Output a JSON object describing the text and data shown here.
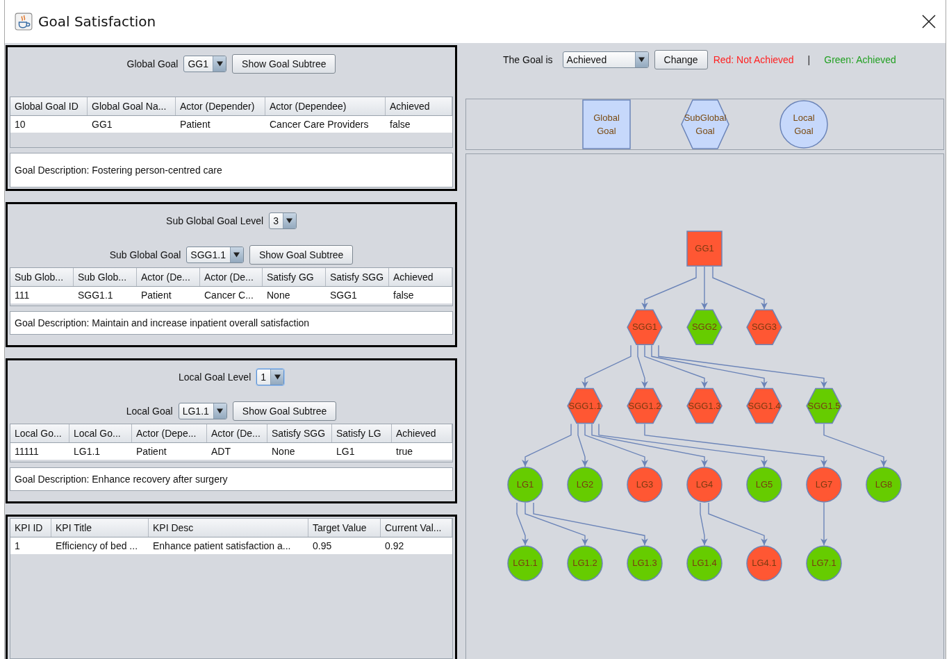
{
  "window": {
    "title": "Goal Satisfaction"
  },
  "sections": [
    {
      "control_rows": [
        {
          "label": "Global Goal",
          "dropdown": {
            "value": "GG1",
            "focused": false
          },
          "button": "Show Goal Subtree"
        }
      ],
      "table": {
        "columns": [
          "Global Goal ID",
          "Global Goal Na...",
          "Actor (Depender)",
          "Actor (Dependee)",
          "Achieved"
        ],
        "rows": [
          [
            "10",
            "GG1",
            "Patient",
            "Cancer Care Providers",
            "false"
          ]
        ]
      },
      "description": "Goal Description: Fostering person-centred care"
    },
    {
      "control_rows": [
        {
          "label": "Sub Global Goal Level",
          "dropdown": {
            "value": "3",
            "focused": false
          }
        },
        {
          "label": "Sub Global Goal",
          "dropdown": {
            "value": "SGG1.1",
            "focused": false
          },
          "button": "Show Goal Subtree"
        }
      ],
      "table": {
        "columns": [
          "Sub Glob...",
          "Sub Glob...",
          "Actor (De...",
          "Actor (De...",
          "Satisfy GG",
          "Satisfy SGG",
          "Achieved"
        ],
        "rows": [
          [
            "111",
            "SGG1.1",
            "Patient",
            "Cancer C...",
            "None",
            "SGG1",
            "false"
          ]
        ]
      },
      "description": "Goal Description: Maintain and increase inpatient overall satisfaction"
    },
    {
      "control_rows": [
        {
          "label": "Local Goal Level",
          "dropdown": {
            "value": "1",
            "focused": true
          }
        },
        {
          "label": "Local Goal",
          "dropdown": {
            "value": "LG1.1",
            "focused": false
          },
          "button": "Show Goal Subtree"
        }
      ],
      "table": {
        "columns": [
          "Local Go...",
          "Local Go...",
          "Actor (Depe...",
          "Actor (De...",
          "Satisfy SGG",
          "Satisfy LG",
          "Achieved"
        ],
        "rows": [
          [
            "11111",
            "LG1.1",
            "Patient",
            "ADT",
            "None",
            "LG1",
            "true"
          ]
        ]
      },
      "description": "Goal Description: Enhance recovery after surgery"
    },
    {
      "table": {
        "columns": [
          "KPI ID",
          "KPI Title",
          "KPI Desc",
          "Target Value",
          "Current Val..."
        ],
        "rows": [
          [
            "1",
            "Efficiency of bed ...",
            "Enhance patient satisfaction a...",
            "0.95",
            "0.92"
          ]
        ]
      }
    }
  ],
  "status": {
    "label": "The Goal is",
    "dropdown": "Achieved",
    "button": "Change",
    "key": [
      {
        "label": "Red: Not Achieved",
        "color": "#ff1f1f"
      },
      {
        "label": "Green: Achieved",
        "color": "#22a022"
      }
    ],
    "separator": "|"
  },
  "legend": [
    {
      "kind": "global",
      "label": "Global Goal"
    },
    {
      "kind": "subglobal",
      "label": "SubGlobal Goal"
    },
    {
      "kind": "local",
      "label": "Local Goal"
    }
  ],
  "tree": {
    "root": {
      "label": "GG1",
      "kind": "global",
      "achieved": false,
      "children": [
        {
          "label": "SGG1",
          "kind": "subglobal",
          "achieved": false,
          "children": [
            {
              "label": "SGG1.1",
              "kind": "subglobal",
              "achieved": false,
              "children": [
                {
                  "label": "LG1",
                  "kind": "local",
                  "achieved": true,
                  "children": [
                    {
                      "label": "LG1.1",
                      "kind": "local",
                      "achieved": true
                    },
                    {
                      "label": "LG1.2",
                      "kind": "local",
                      "achieved": true
                    },
                    {
                      "label": "LG1.3",
                      "kind": "local",
                      "achieved": true
                    }
                  ]
                },
                {
                  "label": "LG2",
                  "kind": "local",
                  "achieved": true
                },
                {
                  "label": "LG3",
                  "kind": "local",
                  "achieved": false
                },
                {
                  "label": "LG4",
                  "kind": "local",
                  "achieved": false,
                  "children": [
                    {
                      "label": "LG1.4",
                      "kind": "local",
                      "achieved": true
                    },
                    {
                      "label": "LG4.1",
                      "kind": "local",
                      "achieved": false
                    }
                  ]
                },
                {
                  "label": "LG5",
                  "kind": "local",
                  "achieved": true
                }
              ]
            },
            {
              "label": "SGG1.2",
              "kind": "subglobal",
              "achieved": false,
              "children": [
                {
                  "label": "LG7",
                  "kind": "local",
                  "achieved": false,
                  "children": [
                    {
                      "label": "LG7.1",
                      "kind": "local",
                      "achieved": true
                    }
                  ]
                }
              ]
            },
            {
              "label": "SGG1.3",
              "kind": "subglobal",
              "achieved": false
            },
            {
              "label": "SGG1.4",
              "kind": "subglobal",
              "achieved": false
            },
            {
              "label": "SGG1.5",
              "kind": "subglobal",
              "achieved": true,
              "children": [
                {
                  "label": "LG8",
                  "kind": "local",
                  "achieved": true
                }
              ]
            }
          ]
        },
        {
          "label": "SGG2",
          "kind": "subglobal",
          "achieved": true
        },
        {
          "label": "SGG3",
          "kind": "subglobal",
          "achieved": false
        }
      ]
    }
  }
}
